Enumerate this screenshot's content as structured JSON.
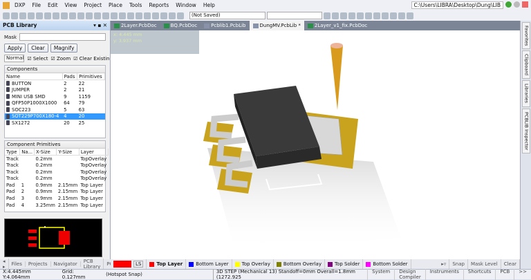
{
  "menu": {
    "items": [
      "DXP",
      "File",
      "Edit",
      "View",
      "Project",
      "Place",
      "Tools",
      "Reports",
      "Window",
      "Help"
    ],
    "path": "C:\\Users\\LIBRA\\Desktop\\Dung\\LIB"
  },
  "toolbar": {
    "save_state": "(Not Saved)"
  },
  "panel": {
    "title": "PCB Library",
    "mask_label": "Mask",
    "apply": "Apply",
    "clear": "Clear",
    "magnify": "Magnify",
    "mode": "Normal",
    "select": "Select",
    "zoom": "Zoom",
    "clear_existing": "Clear Existing",
    "components": {
      "title": "Components",
      "headers": [
        "Name",
        "Pads",
        "Primitives"
      ],
      "rows": [
        [
          "BUTTON",
          "2",
          "22"
        ],
        [
          "JUMPER",
          "2",
          "21"
        ],
        [
          "MINI USB SMD",
          "9",
          "1159"
        ],
        [
          "QFP50P1000X1000",
          "64",
          "79"
        ],
        [
          "SOC223",
          "5",
          "63"
        ],
        [
          "SOT229P700X180-4",
          "4",
          "20"
        ],
        [
          "SX1272",
          "20",
          "25"
        ]
      ],
      "selected": 5
    },
    "primitives": {
      "title": "Component Primitives",
      "headers": [
        "Type",
        "Na...",
        "X-Size",
        "Y-Size",
        "Layer"
      ],
      "rows": [
        [
          "Track",
          "",
          "0.2mm",
          "",
          "TopOverlay"
        ],
        [
          "Track",
          "",
          "0.2mm",
          "",
          "TopOverlay"
        ],
        [
          "Track",
          "",
          "0.2mm",
          "",
          "TopOverlay"
        ],
        [
          "Track",
          "",
          "0.2mm",
          "",
          "TopOverlay"
        ],
        [
          "Pad",
          "1",
          "0.9mm",
          "2.15mm",
          "Top Layer"
        ],
        [
          "Pad",
          "2",
          "0.9mm",
          "2.15mm",
          "Top Layer"
        ],
        [
          "Pad",
          "3",
          "0.9mm",
          "2.15mm",
          "Top Layer"
        ],
        [
          "Pad",
          "4",
          "3.25mm",
          "2.15mm",
          "Top Layer"
        ]
      ]
    },
    "tabs": [
      "Files",
      "Projects",
      "Navigator",
      "PCB Library",
      "PC"
    ]
  },
  "doc_tabs": [
    {
      "label": "2Layer.PcbDoc",
      "type": "pcb"
    },
    {
      "label": "BQ.PcbDoc",
      "type": "pcb"
    },
    {
      "label": "Pcblib1.PcbLib",
      "type": "lib"
    },
    {
      "label": "DungMV.PcbLib *",
      "type": "lib",
      "active": true
    },
    {
      "label": "2Layer_v1_fix.PcbDoc",
      "type": "pcb"
    }
  ],
  "overlay": {
    "x": "x:  4.445 mm",
    "y": "y:  3.937 mm"
  },
  "right_tabs": [
    "Favorites",
    "Clipboard",
    "Libraries",
    "PCBLIB Inspector"
  ],
  "layers": {
    "current": "LS",
    "items": [
      {
        "label": "Top Layer",
        "color": "#ff0000"
      },
      {
        "label": "Bottom Layer",
        "color": "#0000ff"
      },
      {
        "label": "Top Overlay",
        "color": "#ffff00"
      },
      {
        "label": "Bottom Overlay",
        "color": "#808000"
      },
      {
        "label": "Top Solder",
        "color": "#800080"
      },
      {
        "label": "Bottom Solder",
        "color": "#ff00ff"
      }
    ],
    "snap": "Snap",
    "mask_level": "Mask Level",
    "clear": "Clear"
  },
  "status": {
    "coords": "X:4.445mm Y:4.064mm",
    "grid": "Grid: 0.127mm",
    "snap": "(Hotspot Snap)",
    "info": "3D STEP  (Mechanical 13)  Standoff=0mm  Overall=1.8mm  (1272.925",
    "buttons": [
      "System",
      "Design Compiler",
      "Instruments",
      "Shortcuts",
      "PCB",
      ">>"
    ]
  }
}
